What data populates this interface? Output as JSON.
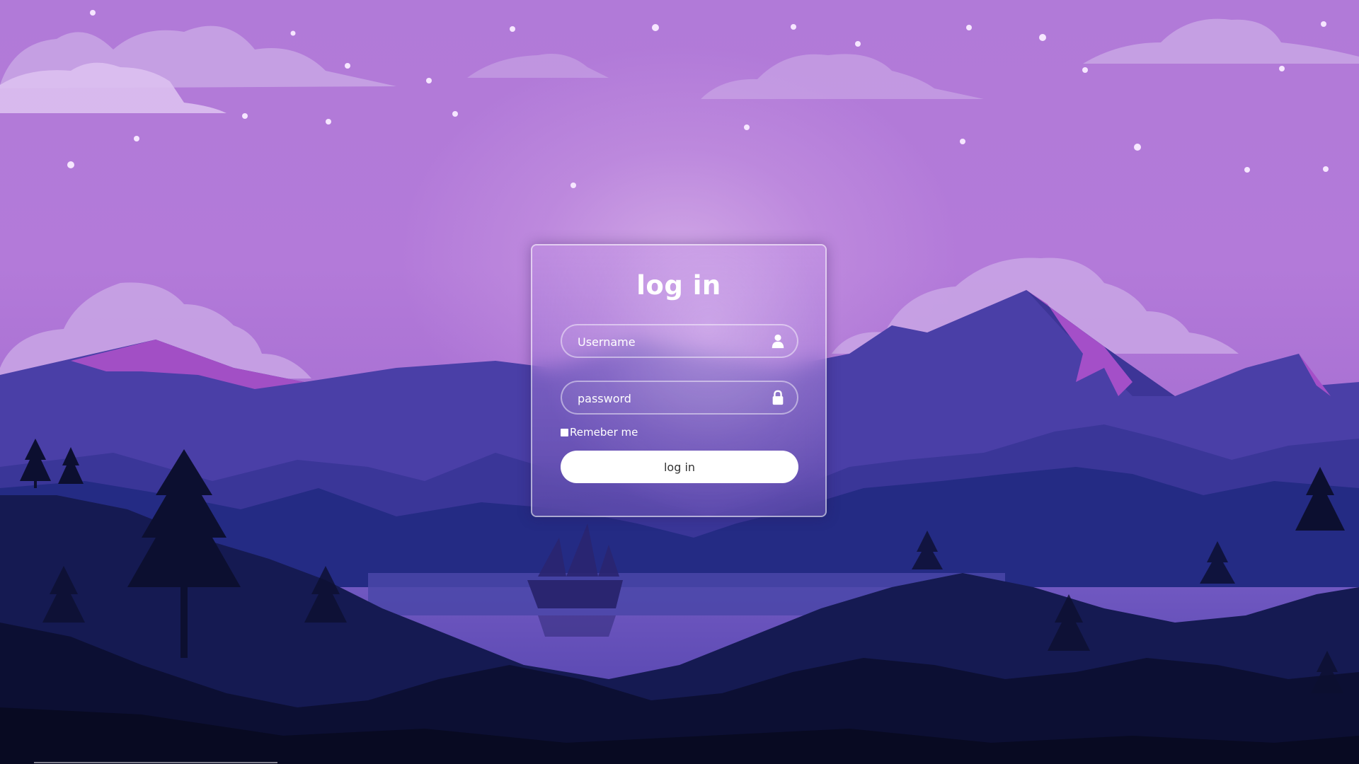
{
  "login": {
    "title": "log in",
    "username_placeholder": "Username",
    "password_placeholder": "password",
    "remember_label": "Remeber me",
    "button_label": "log in"
  },
  "icons": {
    "username": "user-icon",
    "password": "lock-icon"
  },
  "colors": {
    "sky": "#b37ad9",
    "button_bg": "#ffffff",
    "button_text": "#333333"
  }
}
